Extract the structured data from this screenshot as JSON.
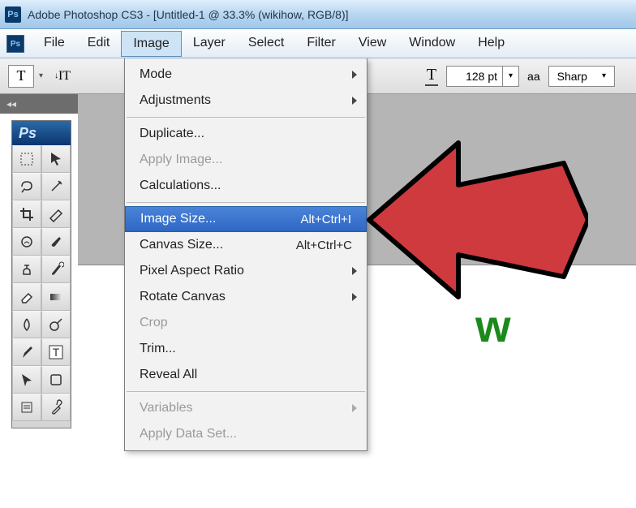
{
  "window": {
    "title": "Adobe Photoshop CS3 - [Untitled-1 @ 33.3% (wikihow, RGB/8)]",
    "logo_text": "Ps"
  },
  "menu_bar": {
    "logo_text": "Ps",
    "items": [
      "File",
      "Edit",
      "Image",
      "Layer",
      "Select",
      "Filter",
      "View",
      "Window",
      "Help"
    ],
    "open_index": 2
  },
  "options_bar": {
    "tool_letter": "T",
    "orientation_icon": "IT",
    "size_value": "128 pt",
    "aa_label": "aa",
    "aa_value": "Sharp"
  },
  "tool_panel": {
    "header": "Ps",
    "tool_names": [
      "marquee-icon",
      "move-icon",
      "lasso-icon",
      "magic-wand-icon",
      "crop-icon",
      "slice-icon",
      "healing-brush-icon",
      "brush-icon",
      "clone-stamp-icon",
      "history-brush-icon",
      "eraser-icon",
      "gradient-icon",
      "blur-icon",
      "dodge-icon",
      "pen-icon",
      "type-icon",
      "path-selection-icon",
      "shape-icon",
      "notes-icon",
      "eyedropper-icon"
    ]
  },
  "dropdown": {
    "groups": [
      [
        {
          "label": "Mode",
          "sub": true
        },
        {
          "label": "Adjustments",
          "sub": true
        }
      ],
      [
        {
          "label": "Duplicate..."
        },
        {
          "label": "Apply Image...",
          "disabled": true
        },
        {
          "label": "Calculations..."
        }
      ],
      [
        {
          "label": "Image Size...",
          "shortcut": "Alt+Ctrl+I",
          "highlight": true
        },
        {
          "label": "Canvas Size...",
          "shortcut": "Alt+Ctrl+C"
        },
        {
          "label": "Pixel Aspect Ratio",
          "sub": true
        },
        {
          "label": "Rotate Canvas",
          "sub": true
        },
        {
          "label": "Crop",
          "disabled": true
        },
        {
          "label": "Trim..."
        },
        {
          "label": "Reveal All"
        }
      ],
      [
        {
          "label": "Variables",
          "sub": true,
          "disabled": true
        },
        {
          "label": "Apply Data Set...",
          "disabled": true
        }
      ]
    ]
  },
  "document": {
    "visible_text": "w"
  },
  "collapse": {
    "glyph": "◂◂"
  },
  "arrow": {
    "fill": "#cf3a3f",
    "stroke": "#000"
  }
}
